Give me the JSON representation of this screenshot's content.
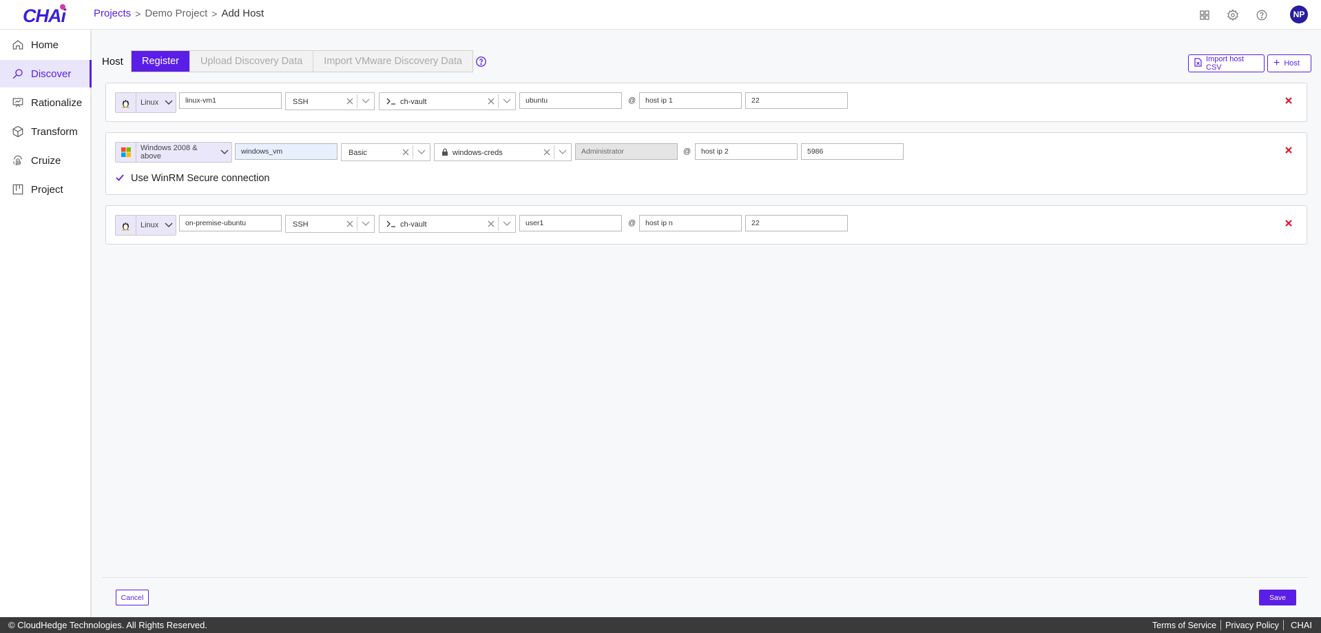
{
  "brand": {
    "logo_text": "CHAi"
  },
  "breadcrumb": {
    "projects": "Projects",
    "project": "Demo Project",
    "current": "Add Host",
    "separator": ">"
  },
  "header": {
    "icons": [
      "grid-icon",
      "gear-icon",
      "help-icon"
    ],
    "avatar_initials": "NP"
  },
  "sidebar": {
    "items": [
      {
        "label": "Home",
        "icon": "home-icon"
      },
      {
        "label": "Discover",
        "icon": "discover-icon",
        "active": true
      },
      {
        "label": "Rationalize",
        "icon": "rationalize-icon"
      },
      {
        "label": "Transform",
        "icon": "cube-icon"
      },
      {
        "label": "Cruize",
        "icon": "fingerprint-icon"
      },
      {
        "label": "Project",
        "icon": "board-icon"
      }
    ]
  },
  "toolbar": {
    "host_label": "Host",
    "tabs": [
      "Register",
      "Upload Discovery Data",
      "Import VMware Discovery Data"
    ],
    "active_tab": "Register",
    "import_csv_label": "Import host CSV",
    "add_host_label": "Host"
  },
  "hosts": [
    {
      "os": "Linux",
      "name": "linux-vm1",
      "protocol": "SSH",
      "credential": "ch-vault",
      "username": "ubuntu",
      "host_ip": "host ip 1",
      "port": "22",
      "at": "@"
    },
    {
      "os": "Windows 2008 & above",
      "name": "windows_vm",
      "protocol": "Basic",
      "credential": "windows-creds",
      "username": "Administrator",
      "host_ip": "host ip 2",
      "port": "5986",
      "at": "@",
      "winrm_label": "Use WinRM Secure connection",
      "winrm_checked": true
    },
    {
      "os": "Linux",
      "name": "on-premise-ubuntu",
      "protocol": "SSH",
      "credential": "ch-vault",
      "username": "user1",
      "host_ip": "host ip n",
      "port": "22",
      "at": "@"
    }
  ],
  "actions": {
    "cancel": "Cancel",
    "save": "Save"
  },
  "footer": {
    "copyright": "© CloudHedge Technologies. All Rights Reserved.",
    "terms": "Terms of Service",
    "privacy": "Privacy Policy",
    "brand": "CHAI"
  },
  "colors": {
    "accent": "#5a1ee6",
    "danger": "#e8132d",
    "footer_bg": "#3a3a3a"
  }
}
